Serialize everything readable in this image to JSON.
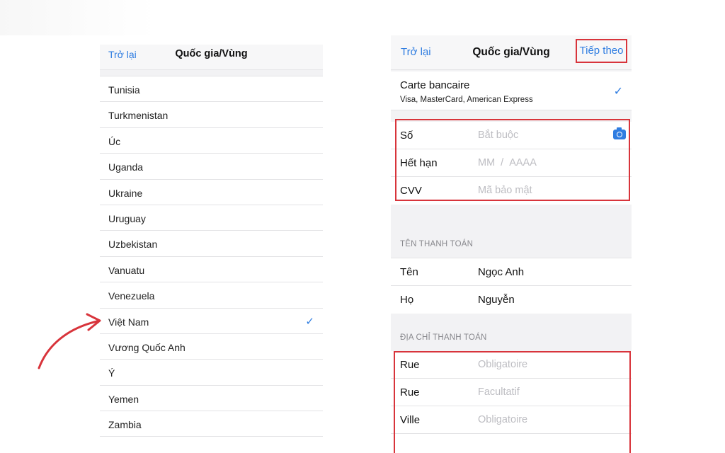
{
  "left": {
    "back_label": "Trở lại",
    "title": "Quốc gia/Vùng",
    "countries": [
      {
        "name": "Tunisia",
        "checked": false
      },
      {
        "name": "Turkmenistan",
        "checked": false
      },
      {
        "name": "Úc",
        "checked": false
      },
      {
        "name": "Uganda",
        "checked": false
      },
      {
        "name": "Ukraine",
        "checked": false
      },
      {
        "name": "Uruguay",
        "checked": false
      },
      {
        "name": "Uzbekistan",
        "checked": false
      },
      {
        "name": "Vanuatu",
        "checked": false
      },
      {
        "name": "Venezuela",
        "checked": false
      },
      {
        "name": "Việt Nam",
        "checked": true
      },
      {
        "name": "Vương Quốc Anh",
        "checked": false
      },
      {
        "name": "Ý",
        "checked": false
      },
      {
        "name": "Yemen",
        "checked": false
      },
      {
        "name": "Zambia",
        "checked": false
      }
    ]
  },
  "right": {
    "back_label": "Trở lại",
    "title": "Quốc gia/Vùng",
    "next_label": "Tiếp theo",
    "card": {
      "name": "Carte bancaire",
      "brands": "Visa, MasterCard, American Express"
    },
    "card_fields": {
      "number_label": "Số",
      "number_placeholder": "Bắt buộc",
      "expiry_label": "Hết hạn",
      "expiry_month_placeholder": "MM",
      "expiry_separator": "/",
      "expiry_year_placeholder": "AAAA",
      "cvv_label": "CVV",
      "cvv_placeholder": "Mã bảo mật"
    },
    "billing_name": {
      "header": "TÊN THANH TOÁN",
      "first_label": "Tên",
      "first_value": "Ngọc Anh",
      "last_label": "Họ",
      "last_value": "Nguyễn"
    },
    "billing_address": {
      "header": "ĐỊA CHỈ THANH TOÁN",
      "street1_label": "Rue",
      "street1_placeholder": "Obligatoire",
      "street2_label": "Rue",
      "street2_placeholder": "Facultatif",
      "city_label": "Ville",
      "city_placeholder": "Obligatoire"
    }
  },
  "colors": {
    "accent": "#2f7de1",
    "highlight_box": "#d8343b",
    "arrow": "#d8343b",
    "placeholder": "#bdbdc2"
  }
}
